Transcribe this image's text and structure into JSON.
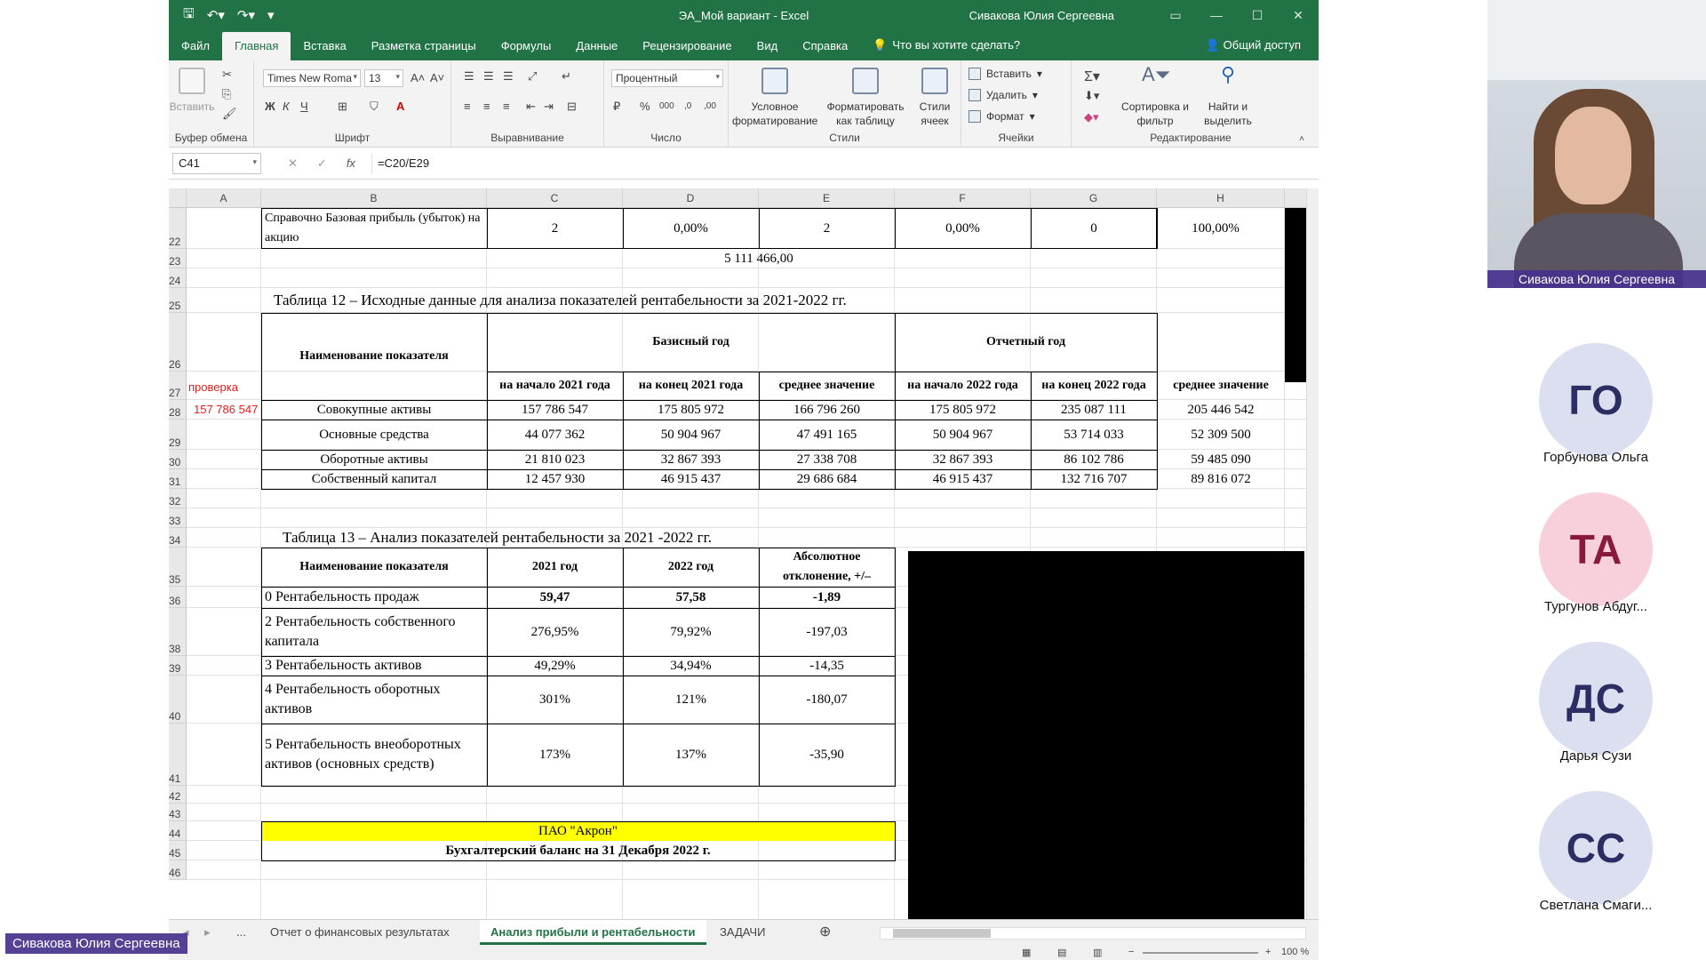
{
  "excel": {
    "title": "ЭА_Мой вариант  -  Excel",
    "user": "Сивакова Юлия Сергеевна",
    "menu": [
      "Файл",
      "Главная",
      "Вставка",
      "Разметка страницы",
      "Формулы",
      "Данные",
      "Рецензирование",
      "Вид",
      "Справка"
    ],
    "tell_me": "Что вы хотите сделать?",
    "share": "Общий доступ",
    "ribbon": {
      "paste": "Вставить",
      "font_name": "Times New Roma",
      "font_size": "13",
      "number_format": "Процентный",
      "groups": [
        "Буфер обмена",
        "Шрифт",
        "Выравнивание",
        "Число",
        "Стили",
        "Ячейки",
        "Редактирование"
      ],
      "cond_format": "Условное форматирование",
      "format_table": "Форматировать как таблицу",
      "cell_styles": "Стили ячеек",
      "insert": "Вставить",
      "delete": "Удалить",
      "format": "Формат",
      "sort_filter": "Сортировка и фильтр",
      "find_select": "Найти и выделить"
    },
    "name_box": "C41",
    "formula": "=C20/E29",
    "columns": [
      "A",
      "B",
      "C",
      "D",
      "E",
      "F",
      "G",
      "H"
    ],
    "rows": [
      "22",
      "23",
      "24",
      "25",
      "26",
      "27",
      "28",
      "29",
      "30",
      "31",
      "32",
      "33",
      "34",
      "35",
      "36",
      "38",
      "39",
      "40",
      "41",
      "42",
      "43",
      "44",
      "45",
      "46"
    ],
    "row22": {
      "b": "Справочно Базовая прибыль (убыток) на акцию",
      "c": "2",
      "d": "0,00%",
      "e": "2",
      "f": "0,00%",
      "g": "0",
      "h": "100,00%"
    },
    "row23_e": "5 111 466,00",
    "table12": {
      "title": "Таблица 12 – Исходные данные для анализа показателей рентабельности за 2021-2022 гг.",
      "head_name": "Наименование показателя",
      "base_year": "Базисный год",
      "report_year": "Отчетный год",
      "sub": [
        "на начало 2021 года",
        "на конец 2021 года",
        "среднее значение",
        "на начало 2022 года",
        "на конец 2022 года",
        "среднее значение"
      ],
      "check_label": "проверка",
      "check_value": "157 786 547",
      "rows": [
        {
          "name": "Совокупные активы",
          "v": [
            "157 786 547",
            "175 805 972",
            "166 796 260",
            "175 805 972",
            "235 087 111",
            "205 446 542"
          ]
        },
        {
          "name": "Основные средства",
          "v": [
            "44 077 362",
            "50 904 967",
            "47 491 165",
            "50 904 967",
            "53 714 033",
            "52 309 500"
          ]
        },
        {
          "name": "Оборотные активы",
          "v": [
            "21 810 023",
            "32 867 393",
            "27 338 708",
            "32 867 393",
            "86 102 786",
            "59 485 090"
          ]
        },
        {
          "name": "Собственный капитал",
          "v": [
            "12 457 930",
            "46 915 437",
            "29 686 684",
            "46 915 437",
            "132 716 707",
            "89 816 072"
          ]
        }
      ]
    },
    "table13": {
      "title": "Таблица 13 – Анализ показателей рентабельности за 2021 -2022 гг.",
      "head": [
        "Наименование показателя",
        "2021 год",
        "2022 год",
        "Абсолютное отклонение, +/–"
      ],
      "rows": [
        {
          "name": "0 Рентабельность продаж",
          "v": [
            "59,47",
            "57,58",
            "-1,89"
          ]
        },
        {
          "name": "2 Рентабельность собственного капитала",
          "v": [
            "276,95%",
            "79,92%",
            "-197,03"
          ]
        },
        {
          "name": "3 Рентабельность активов",
          "v": [
            "49,29%",
            "34,94%",
            "-14,35"
          ]
        },
        {
          "name": "4 Рентабельность оборотных активов",
          "v": [
            "301%",
            "121%",
            "-180,07"
          ]
        },
        {
          "name": "5 Рентабельность внеоборотных активов (основных средств)",
          "v": [
            "173%",
            "137%",
            "-35,90"
          ]
        }
      ]
    },
    "company": "ПАО \"Акрон\"",
    "balance_title": "Бухгалтерский баланс на 31 Декабря 2022 г.",
    "sheet_tabs": [
      "...",
      "Отчет о финансовых результатах",
      "Анализ прибыли и рентабельности",
      "ЗАДАЧИ"
    ],
    "zoom": "100 %"
  },
  "participants": {
    "presenter_label": "Сивакова Юлия Сергеевна",
    "list": [
      {
        "initials": "ГО",
        "name": "Горбунова Ольга"
      },
      {
        "initials": "ТА",
        "name": "Тургунов Абдуг..."
      },
      {
        "initials": "ДС",
        "name": "Дарья Сузи"
      },
      {
        "initials": "СС",
        "name": "Светлана Смаги..."
      }
    ],
    "bottom_label": "Сивакова Юлия Сергеевна"
  },
  "colors": {
    "excel_green": "#217346",
    "avatar_bg": "#dcdff0",
    "avatar_pink": "#f7d0dc",
    "avatar_text": "#8a1a3c"
  }
}
